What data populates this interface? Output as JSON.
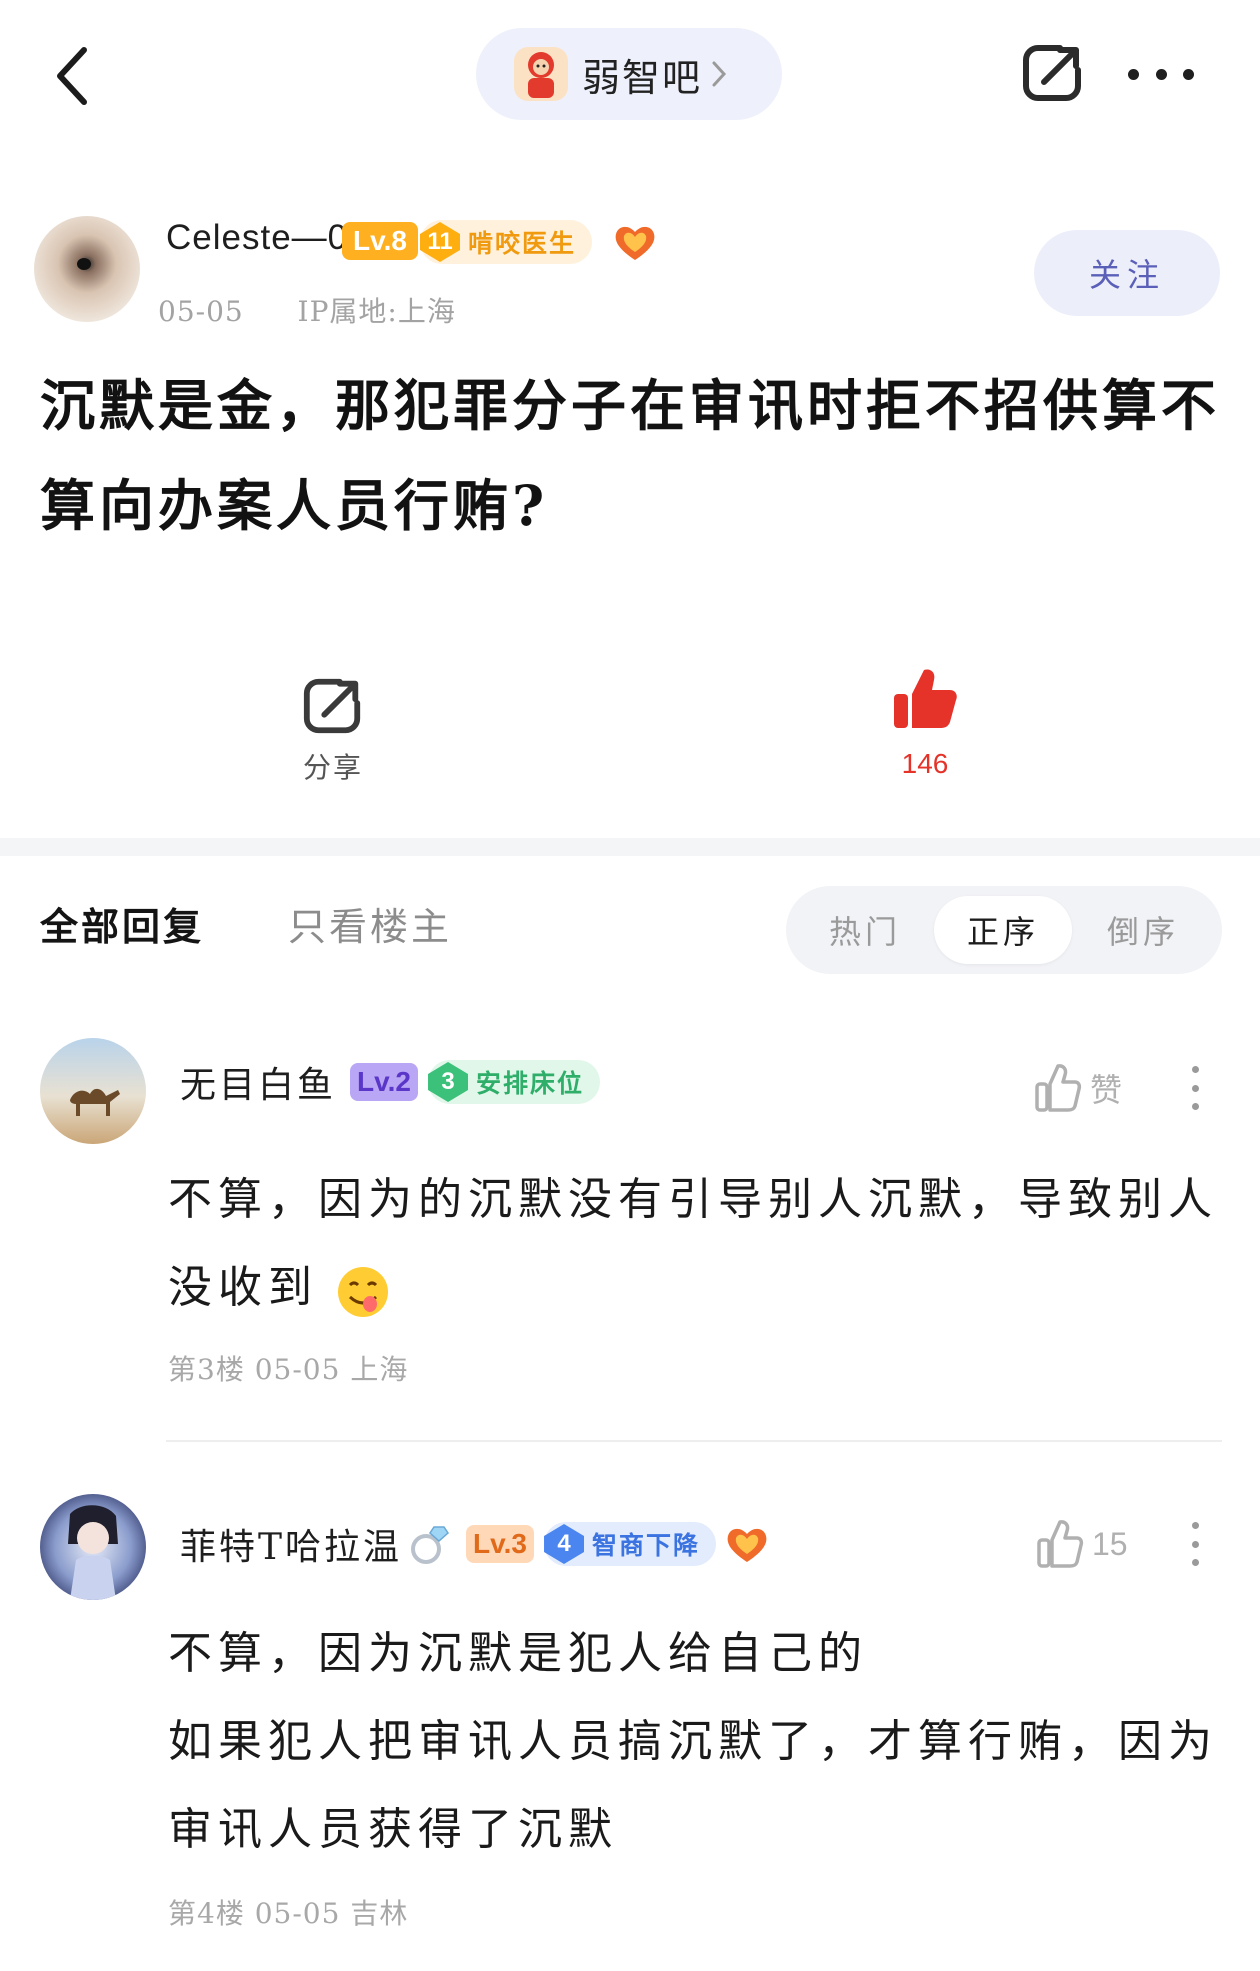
{
  "header": {
    "forum_name": "弱智吧",
    "icons": {
      "back": "chevron-left-icon",
      "share": "share-icon",
      "more": "more-dots-icon",
      "forum": "forum-avatar"
    }
  },
  "post": {
    "author": {
      "name": "Celeste—0",
      "level": "Lv.8",
      "title_num": "11",
      "title_text": "啃咬医生",
      "date": "05-05",
      "ip": "IP属地:上海"
    },
    "follow_label": "关注",
    "title": "沉默是金，那犯罪分子在审讯时拒不招供算不算向办案人员行贿?",
    "actions": {
      "share_label": "分享",
      "like_count": "146"
    }
  },
  "reply_tabs": {
    "all": "全部回复",
    "op_only": "只看楼主",
    "sort": [
      "热门",
      "正序",
      "倒序"
    ],
    "sort_active": "正序"
  },
  "comments": [
    {
      "name": "无目白鱼",
      "level": "Lv.2",
      "title_num": "3",
      "title_text": "安排床位",
      "like_label": "赞",
      "body_line1": "不算，因为的沉默没有引导别人沉默，导致别人",
      "body_line2": "没收到",
      "emoji": "😋",
      "meta": "第3楼  05-05  上海"
    },
    {
      "name": "菲特T哈拉温",
      "name_emoji": "💍",
      "level": "Lv.3",
      "title_num": "4",
      "title_text": "智商下降",
      "like_label": "15",
      "body_line1": "不算，因为沉默是犯人给自己的",
      "body_line2": "如果犯人把审讯人员搞沉默了，才算行贿，因为",
      "body_line3": "审讯人员获得了沉默",
      "meta": "第4楼  05-05  吉林"
    }
  ],
  "colors": {
    "accent": "#e5332a",
    "follow_text": "#5a5fb8",
    "pill_bg": "#eef0fb"
  }
}
